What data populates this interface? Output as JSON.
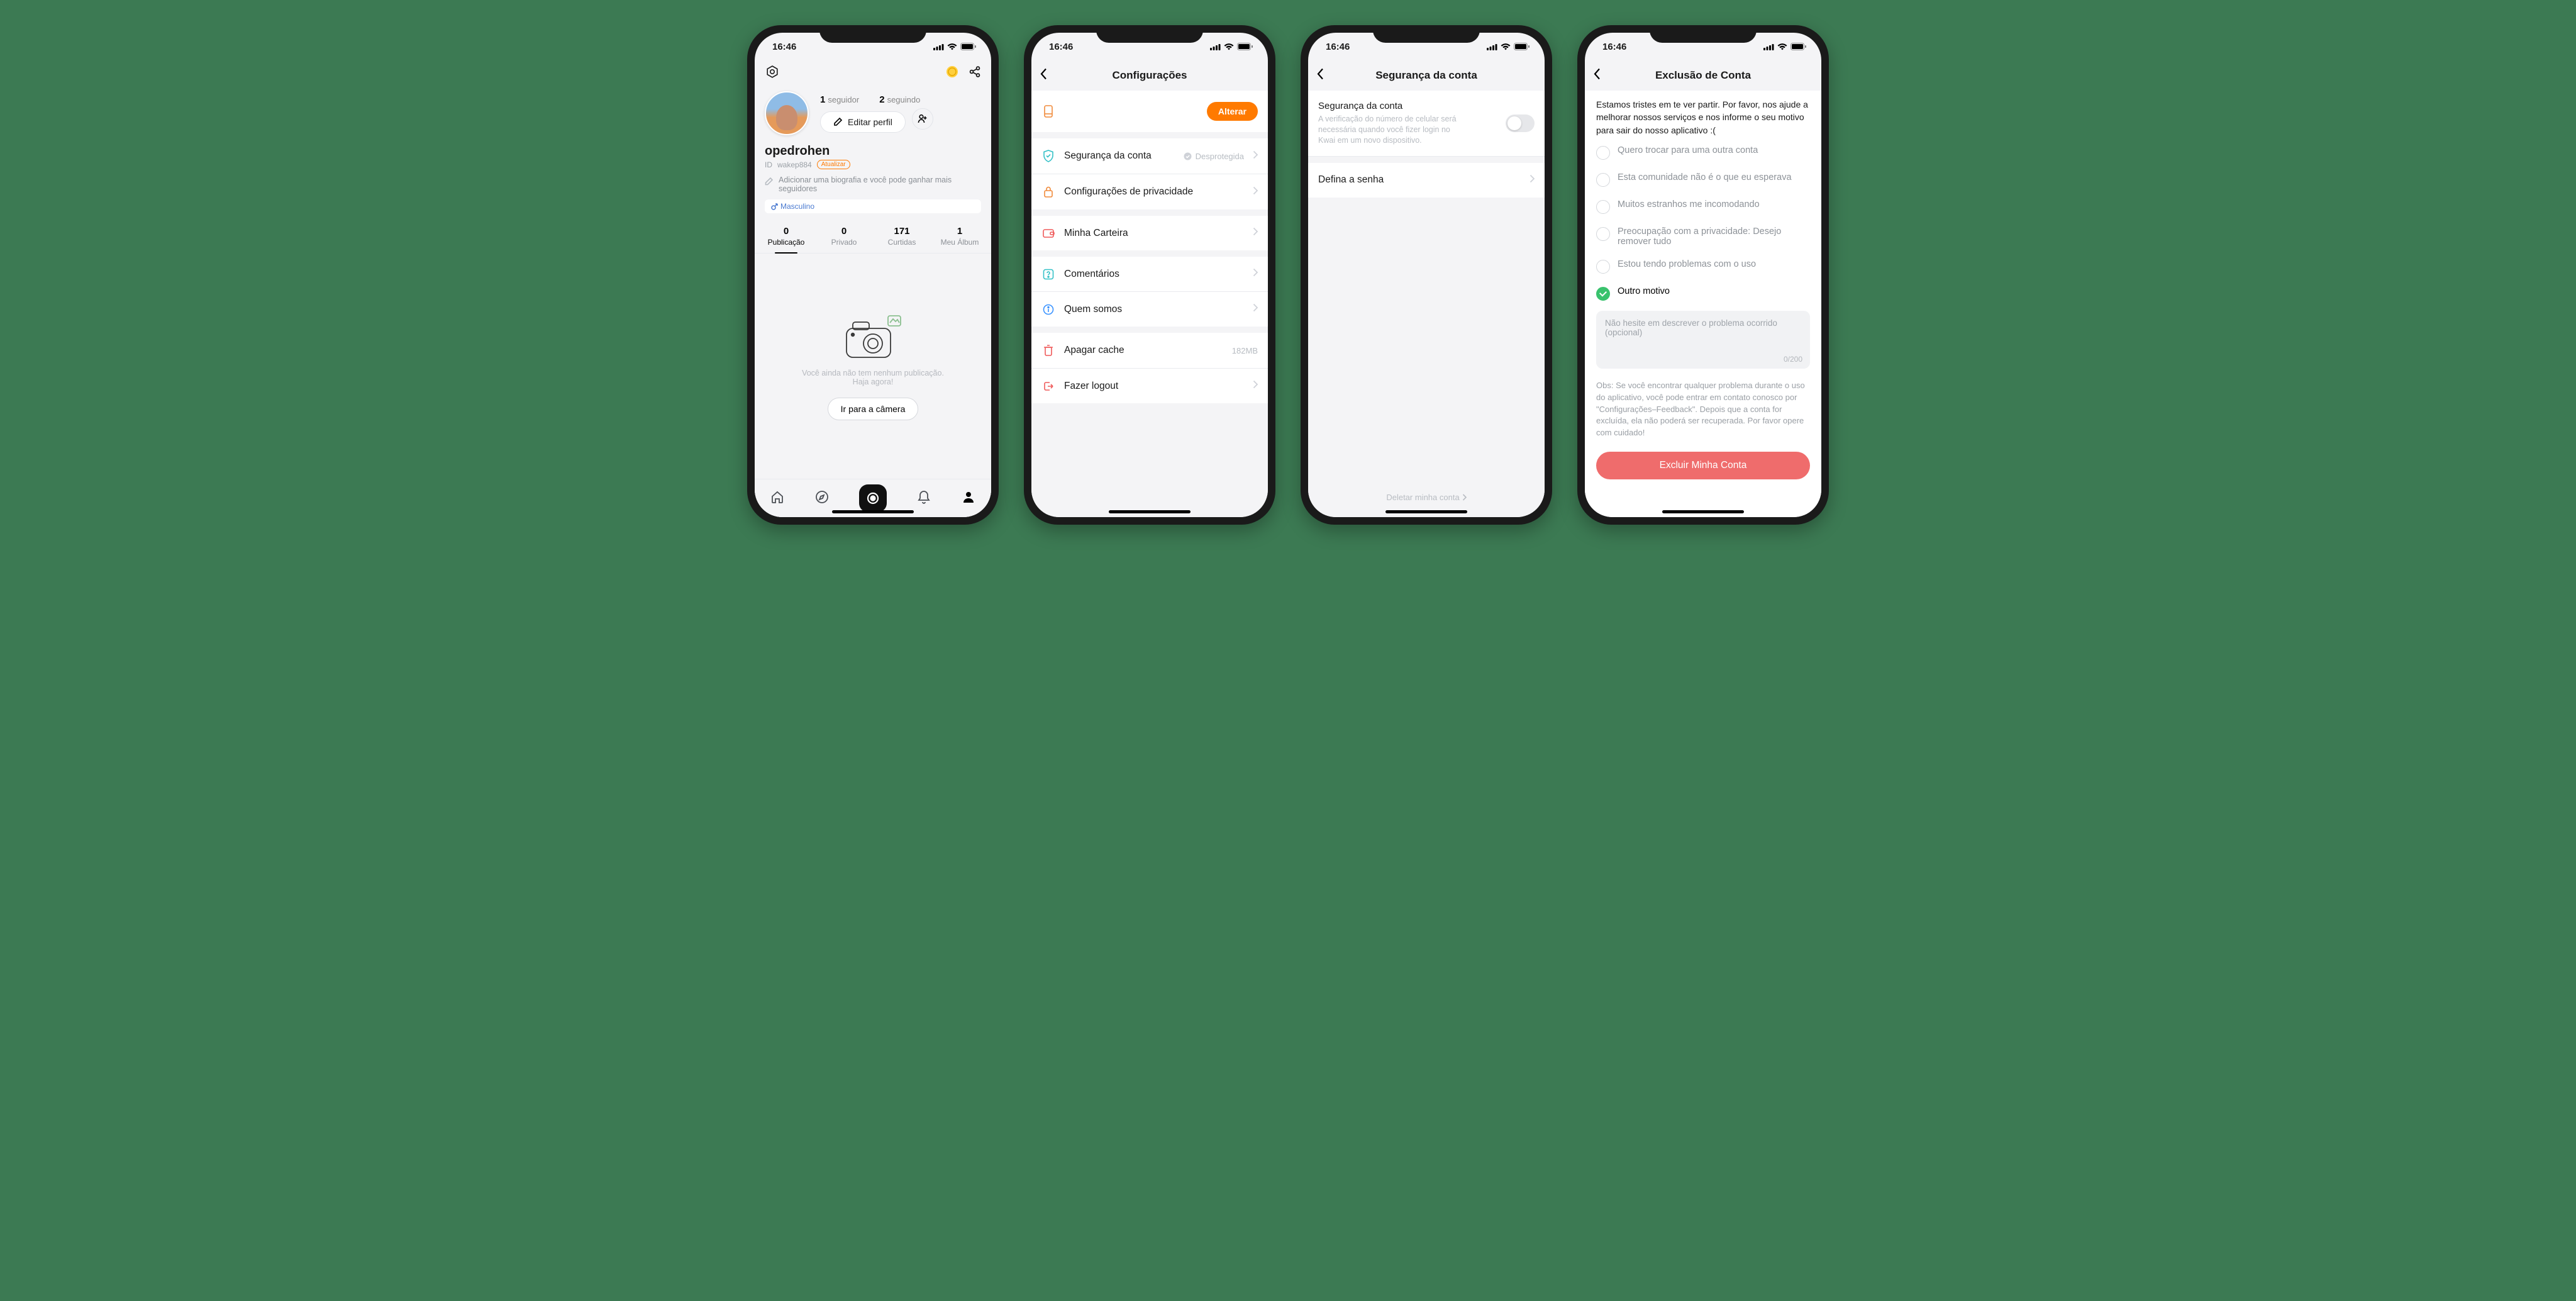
{
  "status": {
    "time": "16:46"
  },
  "profile": {
    "followers_n": "1",
    "followers_l": "seguidor",
    "following_n": "2",
    "following_l": "seguindo",
    "edit_label": "Editar perfil",
    "username": "opedrohen",
    "id_prefix": "ID",
    "id_value": "wakep884",
    "update_badge": "Atualizar",
    "bio_hint": "Adicionar uma biografia e você pode ganhar mais seguidores",
    "gender": "Masculino",
    "tabs": [
      {
        "n": "0",
        "l": "Publicação"
      },
      {
        "n": "0",
        "l": "Privado"
      },
      {
        "n": "171",
        "l": "Curtidas"
      },
      {
        "n": "1",
        "l": "Meu Álbum"
      }
    ],
    "empty_l1": "Você ainda não tem nenhum publicação.",
    "empty_l2": "Haja agora!",
    "camera_btn": "Ir para a câmera"
  },
  "settings": {
    "title": "Configurações",
    "alter_btn": "Alterar",
    "items": {
      "security": {
        "label": "Segurança da conta",
        "status": "Desprotegida"
      },
      "privacy": {
        "label": "Configurações de privacidade"
      },
      "wallet": {
        "label": "Minha Carteira"
      },
      "comments": {
        "label": "Comentários"
      },
      "about": {
        "label": "Quem somos"
      },
      "cache": {
        "label": "Apagar cache",
        "size": "182MB"
      },
      "logout": {
        "label": "Fazer logout"
      }
    }
  },
  "security": {
    "title": "Segurança da conta",
    "row1_title": "Segurança da conta",
    "row1_sub": "A verificação do número de celular será necessária quando você fizer login no Kwai em um novo dispositivo.",
    "row2": "Defina a senha",
    "delete_link": "Deletar minha conta"
  },
  "deletion": {
    "title": "Exclusão de Conta",
    "intro": "Estamos tristes em te ver partir. Por favor, nos ajude a melhorar nossos serviços e nos informe o seu motivo para sair do nosso aplicativo :(",
    "options": [
      "Quero trocar para uma outra conta",
      "Esta comunidade não é o que eu esperava",
      "Muitos estranhos me incomodando",
      "Preocupação com a privacidade: Desejo remover tudo",
      "Estou tendo problemas com o uso",
      "Outro motivo"
    ],
    "placeholder": "Não hesite em descrever o problema ocorrido (opcional)",
    "counter": "0/200",
    "note": "Obs: Se você encontrar qualquer problema durante o uso do aplicativo, você pode entrar em contato conosco por \"Configurações–Feedback\". Depois que a conta for excluída, ela não poderá ser recuperada. Por favor opere com cuidado!",
    "btn": "Excluir Minha Conta"
  }
}
